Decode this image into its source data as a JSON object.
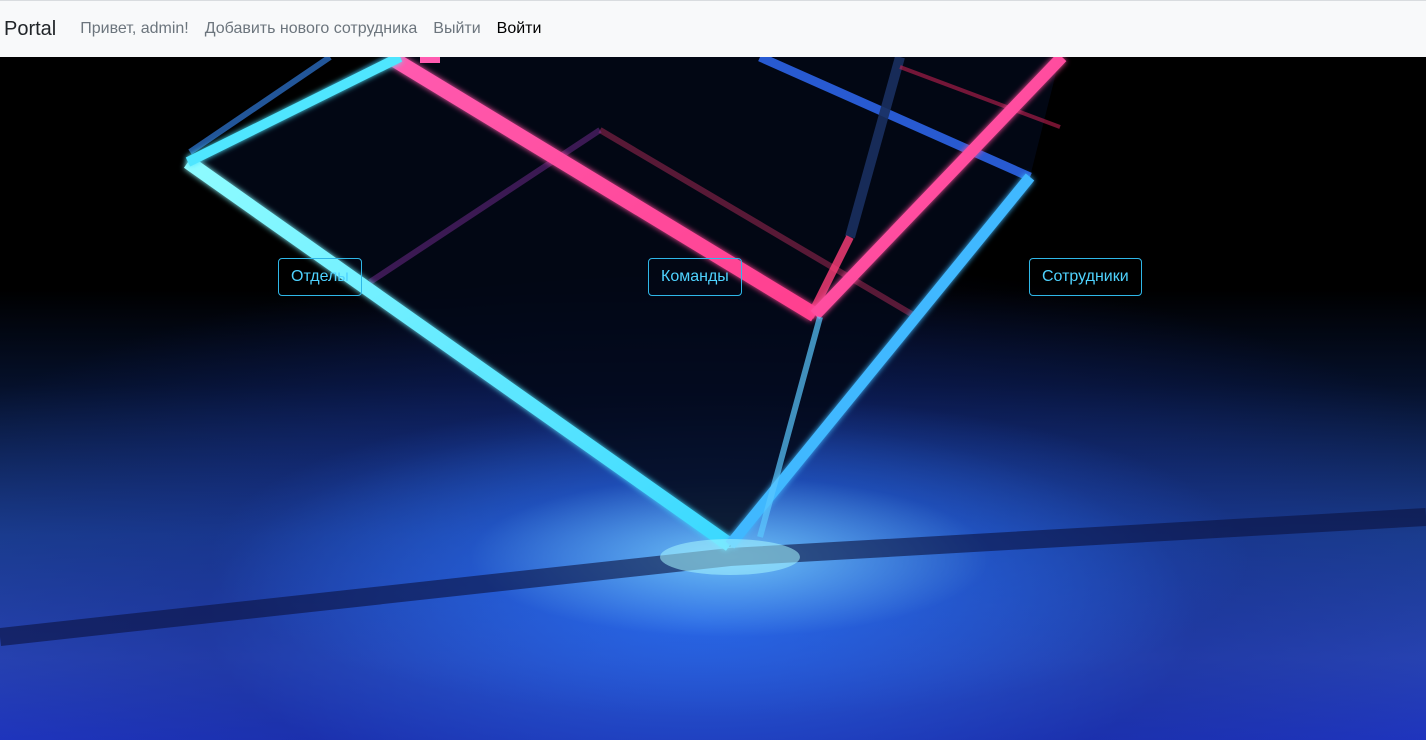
{
  "navbar": {
    "brand": "Portal",
    "links": [
      {
        "label": "Привет, admin!"
      },
      {
        "label": "Добавить нового сотрудника"
      },
      {
        "label": "Выйти"
      },
      {
        "label": "Войти"
      }
    ]
  },
  "hero": {
    "buttons": [
      {
        "label": "Отделы"
      },
      {
        "label": "Команды"
      },
      {
        "label": "Сотрудники"
      }
    ]
  },
  "colors": {
    "navbar_bg": "#f8f9fa",
    "button_accent": "#4fd3ff",
    "neon_pink": "#ff4fa8",
    "neon_cyan": "#5ff5ff"
  }
}
